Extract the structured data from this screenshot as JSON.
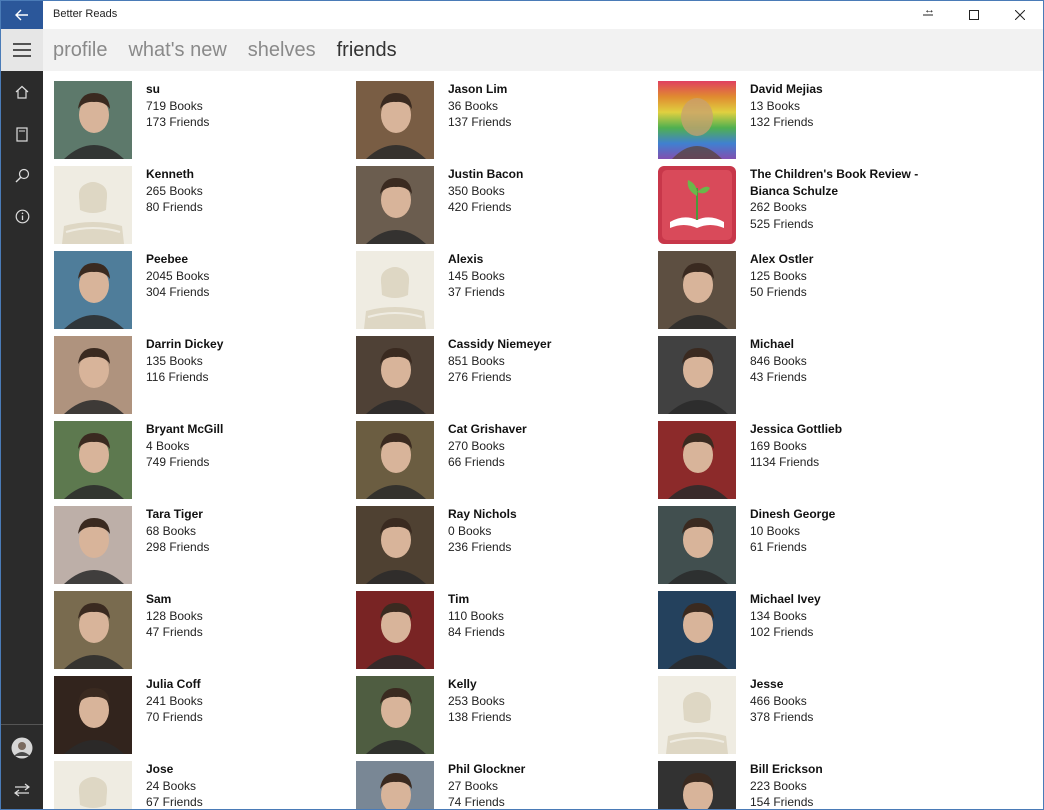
{
  "window": {
    "title": "Better Reads"
  },
  "tabs": [
    {
      "label": "profile",
      "active": false
    },
    {
      "label": "what's new",
      "active": false
    },
    {
      "label": "shelves",
      "active": false
    },
    {
      "label": "friends",
      "active": true
    }
  ],
  "sidebar": {
    "icons": [
      "menu-icon",
      "home-icon",
      "book-icon",
      "search-icon",
      "info-icon",
      "user-avatar",
      "switch-icon"
    ]
  },
  "colors": {
    "accent": "#2b579a",
    "sidebar": "#2b2b2b",
    "header": "#f2f2f2",
    "placeholder_bg": "#efece2",
    "placeholder_fg": "#ded7c4"
  },
  "friends": [
    {
      "name": "su",
      "books": "719 Books",
      "friends": "173 Friends",
      "avatar": "photo",
      "color": "#6a8a7a"
    },
    {
      "name": "Jason Lim",
      "books": "36 Books",
      "friends": "137 Friends",
      "avatar": "photo",
      "color": "#8a6a4e"
    },
    {
      "name": "David Mejias",
      "books": "13 Books",
      "friends": "132 Friends",
      "avatar": "rainbow",
      "color": "#c05a8a"
    },
    {
      "name": "Kenneth",
      "books": "265 Books",
      "friends": "80 Friends",
      "avatar": "placeholder",
      "color": "#efece2"
    },
    {
      "name": "Justin Bacon",
      "books": "350 Books",
      "friends": "420 Friends",
      "avatar": "photo",
      "color": "#7a6a5a"
    },
    {
      "name": "The Children's Book Review - Bianca Schulze",
      "books": "262 Books",
      "friends": "525 Friends",
      "avatar": "book-logo",
      "color": "#c8374a"
    },
    {
      "name": "Peebee",
      "books": "2045 Books",
      "friends": "304 Friends",
      "avatar": "photo",
      "color": "#5b8fb0"
    },
    {
      "name": "Alexis",
      "books": "145 Books",
      "friends": "37 Friends",
      "avatar": "placeholder",
      "color": "#efece2"
    },
    {
      "name": "Alex Ostler",
      "books": "125 Books",
      "friends": "50 Friends",
      "avatar": "photo",
      "color": "#6a5a4a"
    },
    {
      "name": "Darrin Dickey",
      "books": "135 Books",
      "friends": "116 Friends",
      "avatar": "photo",
      "color": "#c8a890"
    },
    {
      "name": "Cassidy Niemeyer",
      "books": "851 Books",
      "friends": "276 Friends",
      "avatar": "photo",
      "color": "#5a4a3e"
    },
    {
      "name": "Michael",
      "books": "846 Books",
      "friends": "43 Friends",
      "avatar": "photo",
      "color": "#4a4a4a"
    },
    {
      "name": "Bryant McGill",
      "books": "4 Books",
      "friends": "749 Friends",
      "avatar": "photo",
      "color": "#6a8a5a"
    },
    {
      "name": "Cat Grishaver",
      "books": "270 Books",
      "friends": "66 Friends",
      "avatar": "photo",
      "color": "#7a6a4a"
    },
    {
      "name": "Jessica Gottlieb",
      "books": "169 Books",
      "friends": "1134 Friends",
      "avatar": "photo",
      "color": "#a03030"
    },
    {
      "name": "Tara Tiger",
      "books": "68 Books",
      "friends": "298 Friends",
      "avatar": "photo",
      "color": "#d8c8c0"
    },
    {
      "name": "Ray Nichols",
      "books": "0 Books",
      "friends": "236 Friends",
      "avatar": "photo",
      "color": "#5a4a3a"
    },
    {
      "name": "Dinesh George",
      "books": "10 Books",
      "friends": "61 Friends",
      "avatar": "photo",
      "color": "#4a5a5a"
    },
    {
      "name": "Sam",
      "books": "128 Books",
      "friends": "47 Friends",
      "avatar": "photo",
      "color": "#8a7a5a"
    },
    {
      "name": "Tim",
      "books": "110 Books",
      "friends": "84 Friends",
      "avatar": "photo",
      "color": "#8a2a2a"
    },
    {
      "name": "Michael Ivey",
      "books": "134 Books",
      "friends": "102 Friends",
      "avatar": "photo",
      "color": "#2a4a6a"
    },
    {
      "name": "Julia Coff",
      "books": "241 Books",
      "friends": "70 Friends",
      "avatar": "photo",
      "color": "#3a2a22"
    },
    {
      "name": "Kelly",
      "books": "253 Books",
      "friends": "138 Friends",
      "avatar": "photo",
      "color": "#5a6a4a"
    },
    {
      "name": "Jesse",
      "books": "466 Books",
      "friends": "378 Friends",
      "avatar": "placeholder",
      "color": "#efece2"
    },
    {
      "name": "Jose",
      "books": "24 Books",
      "friends": "67 Friends",
      "avatar": "placeholder",
      "color": "#efece2"
    },
    {
      "name": "Phil Glockner",
      "books": "27 Books",
      "friends": "74 Friends",
      "avatar": "photo",
      "color": "#8a9aaa"
    },
    {
      "name": "Bill Erickson",
      "books": "223 Books",
      "friends": "154 Friends",
      "avatar": "photo",
      "color": "#3a3a3a"
    }
  ]
}
